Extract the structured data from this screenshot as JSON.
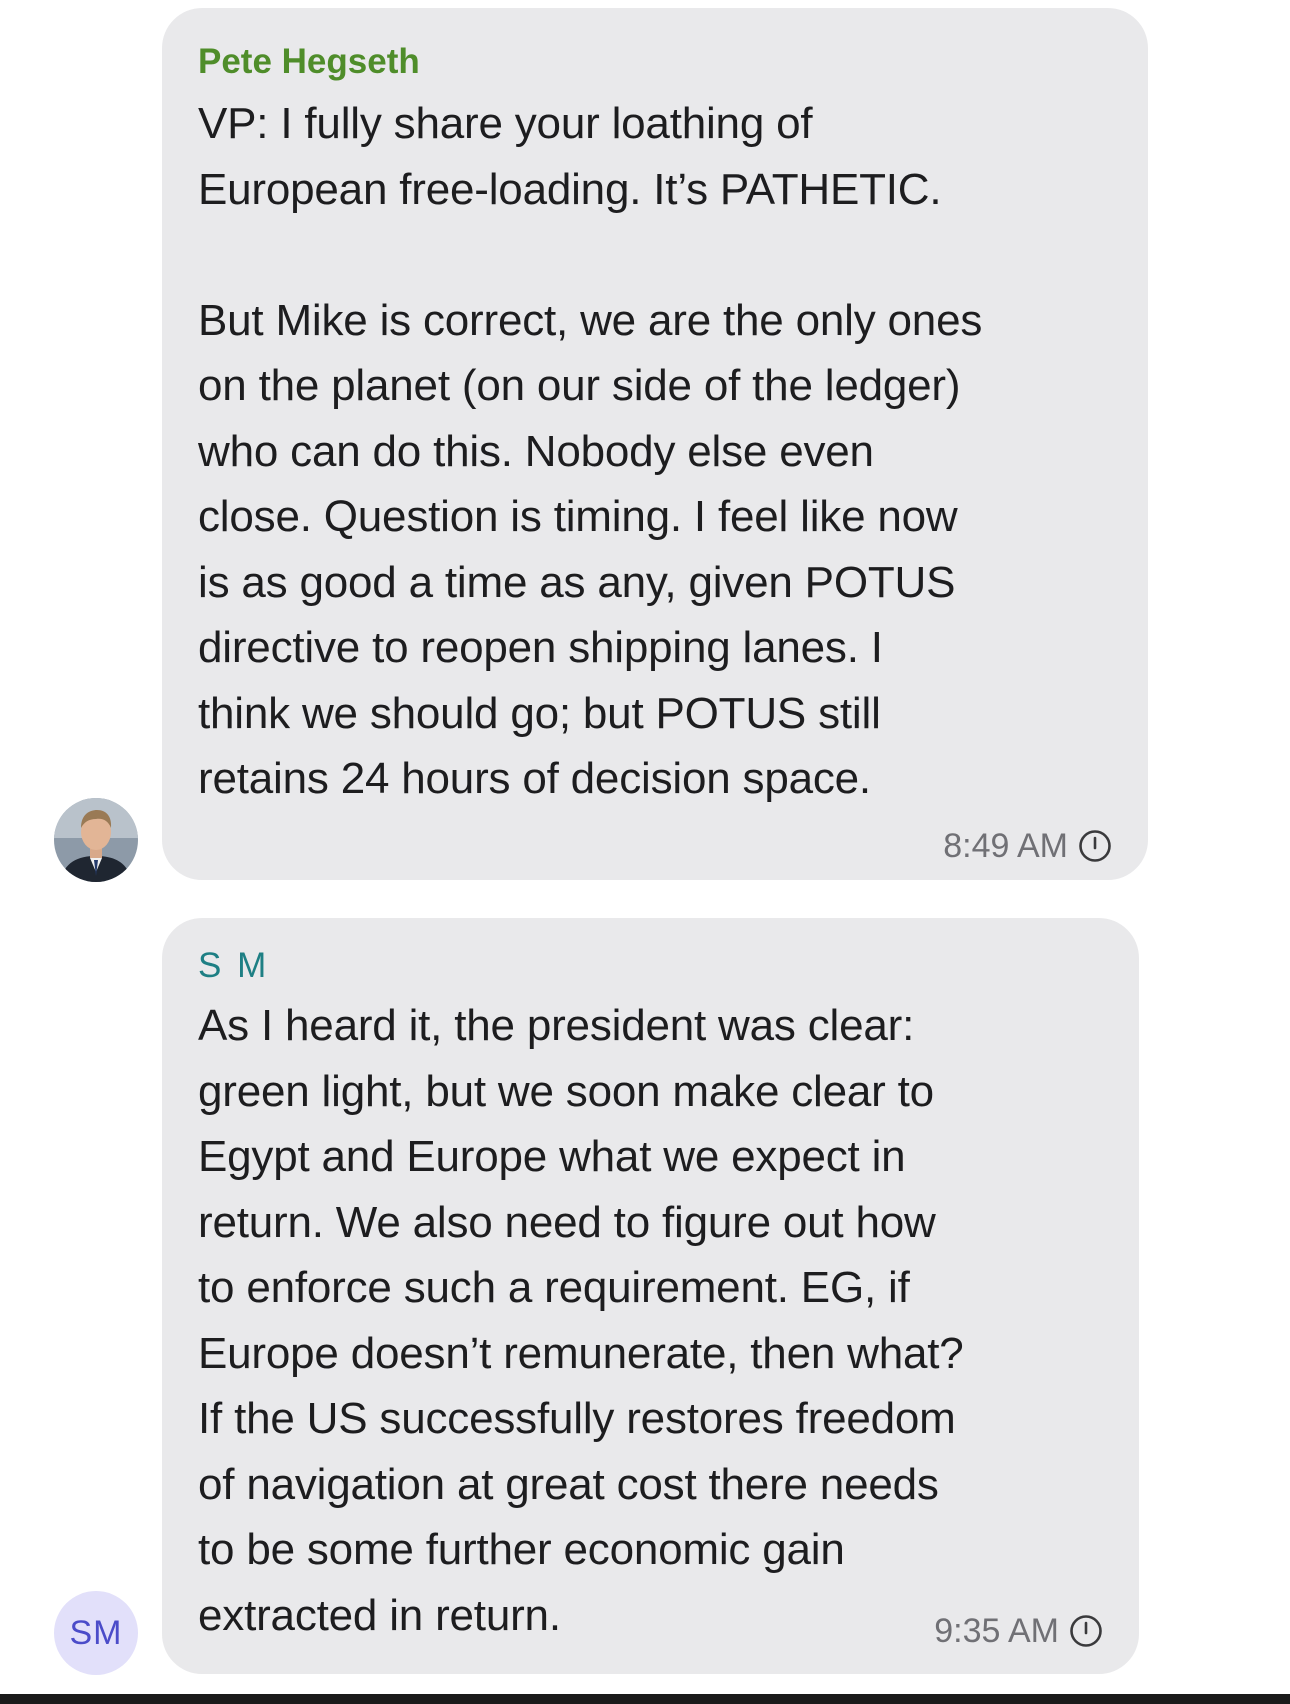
{
  "messages": [
    {
      "sender": "Pete Hegseth",
      "sender_color": "#4f8d2a",
      "text": "VP: I fully share your loathing of\nEuropean free-loading. It’s PATHETIC.\n\nBut Mike is correct, we are the only ones\non the planet (on our side of the ledger)\nwho can do this. Nobody else even\nclose. Question is timing. I feel like now\nis as good a time as any, given POTUS\ndirective to reopen shipping lanes. I\nthink we should go; but POTUS still\nretains 24 hours of decision space.",
      "time": "8:49 AM",
      "status_icon": "clock-pending-icon"
    },
    {
      "sender": "S M",
      "sender_color": "#1e7f84",
      "text": "As I heard it, the president was clear:\ngreen light, but we soon make clear to\nEgypt and Europe what we expect in\nreturn. We also need to figure out how\nto enforce such a requirement. EG, if\nEurope doesn’t remunerate, then what?\nIf the US successfully restores freedom\nof navigation at great cost there needs\nto be some further economic gain\nextracted in return.",
      "time": "9:35 AM",
      "status_icon": "clock-pending-icon",
      "avatar_initials": "SM"
    }
  ],
  "colors": {
    "bubble": "#e9e9eb",
    "text": "#1d1d1f",
    "timestamp": "#707075",
    "sm_avatar_bg": "#e2e0fa",
    "sm_avatar_text": "#4b4cc9"
  }
}
